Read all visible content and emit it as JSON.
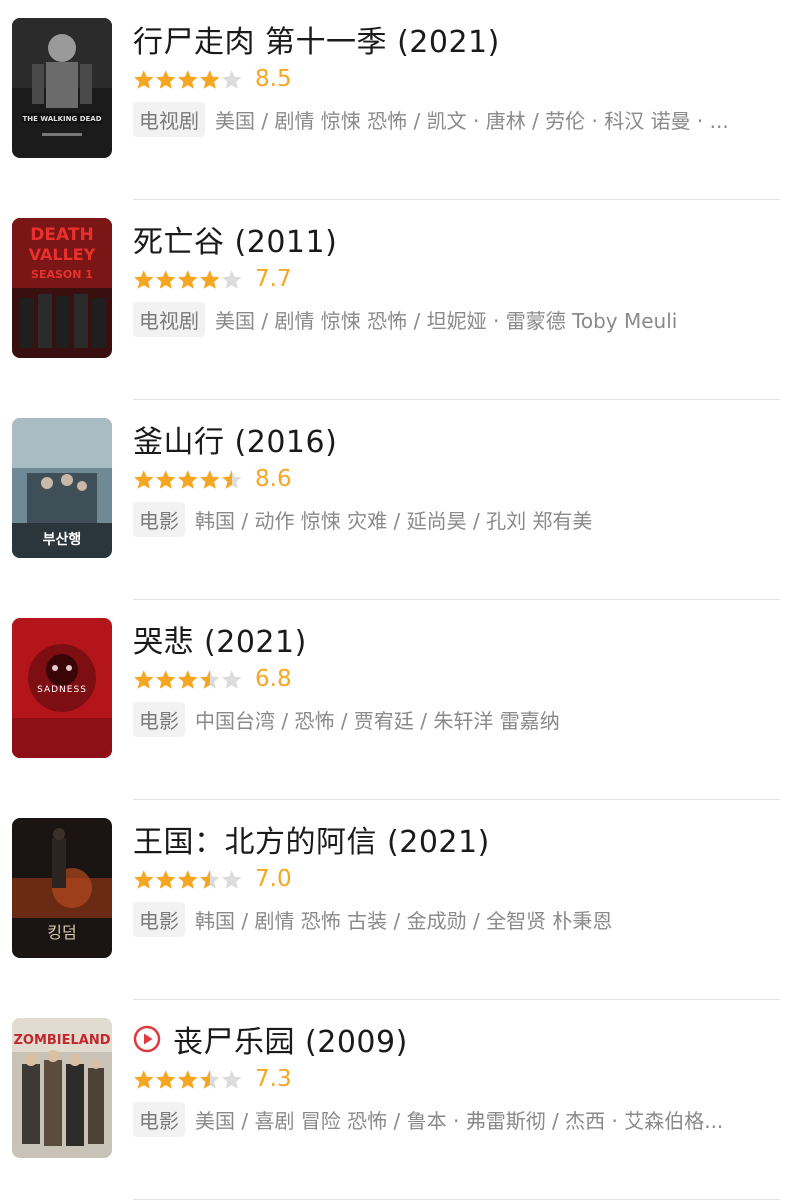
{
  "items": [
    {
      "title": "行尸走肉 第十一季 (2021)",
      "rating": 8.5,
      "stars": 4.0,
      "score": "8.5",
      "tag": "电视剧",
      "meta": "美国 / 剧情 惊悚 恐怖 / 凯文 · 唐林 / 劳伦 · 科汉 诺曼 · ...",
      "poster": "walking-dead-poster",
      "poster_text": "THE WALKING DEAD",
      "has_play": false
    },
    {
      "title": "死亡谷  (2011)",
      "rating": 7.7,
      "stars": 4.0,
      "score": "7.7",
      "tag": "电视剧",
      "meta": "美国 / 剧情 惊悚 恐怖 / 坦妮娅 · 雷蒙德 Toby Meuli",
      "poster": "death-valley-poster",
      "poster_text": "DEATH VALLEY SEASON 1",
      "has_play": false
    },
    {
      "title": "釜山行 (2016)",
      "rating": 8.6,
      "stars": 4.5,
      "score": "8.6",
      "tag": "电影",
      "meta": "韩国 / 动作 惊悚 灾难 / 延尚昊 / 孔刘 郑有美",
      "poster": "train-to-busan-poster",
      "poster_text": "부산행",
      "has_play": false
    },
    {
      "title": "哭悲 (2021)",
      "rating": 6.8,
      "stars": 3.5,
      "score": "6.8",
      "tag": "电影",
      "meta": "中国台湾 / 恐怖 / 贾宥廷 / 朱轩洋 雷嘉纳",
      "poster": "the-sadness-poster",
      "poster_text": "SADNESS",
      "has_play": false
    },
    {
      "title": "王国：北方的阿信 (2021)",
      "rating": 7.0,
      "stars": 3.5,
      "score": "7.0",
      "tag": "电影",
      "meta": "韩国 / 剧情 恐怖 古装 / 金成勋 / 全智贤 朴秉恩",
      "poster": "kingdom-ashin-poster",
      "poster_text": "킹덤",
      "has_play": false
    },
    {
      "title": "丧尸乐园 (2009)",
      "rating": 7.3,
      "stars": 3.5,
      "score": "7.3",
      "tag": "电影",
      "meta": "美国 / 喜剧 冒险 恐怖 / 鲁本 · 弗雷斯彻 / 杰西 · 艾森伯格...",
      "poster": "zombieland-poster",
      "poster_text": "ZOMBIELAND",
      "has_play": true
    }
  ],
  "colors": {
    "star": "#f5a623",
    "star_empty": "#dcdcdc",
    "play": "#e0393e"
  },
  "icons": {
    "play": "play-circle-icon",
    "star": "star-icon"
  }
}
